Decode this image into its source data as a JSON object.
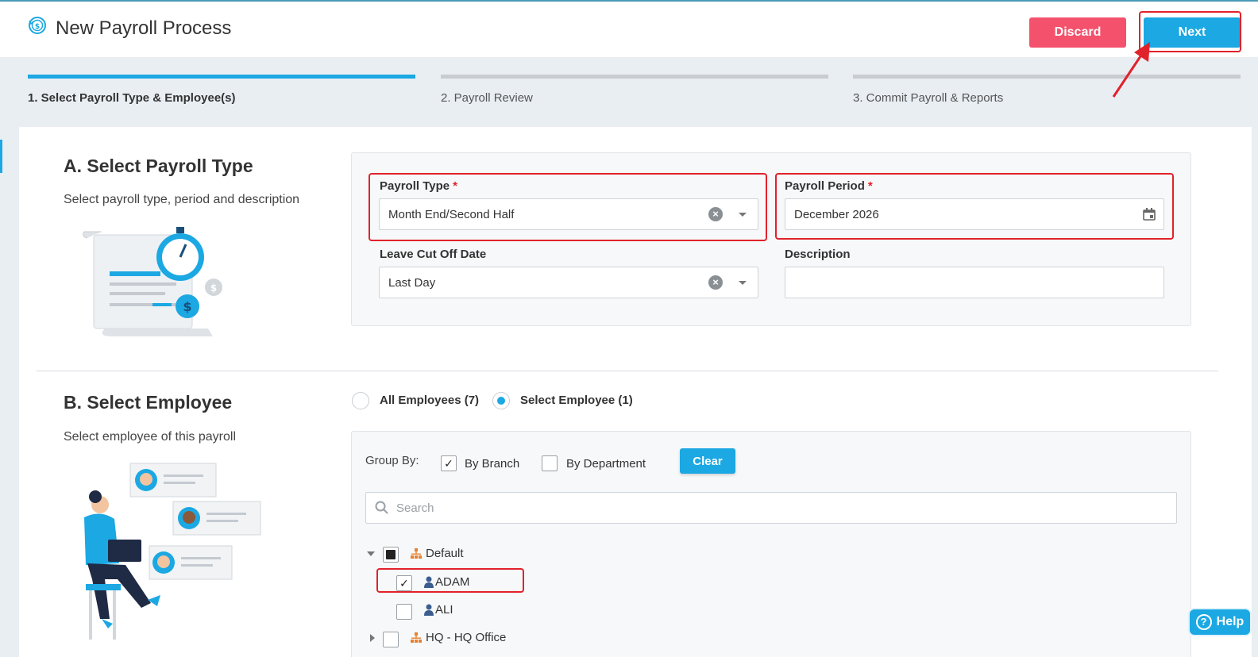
{
  "header": {
    "title": "New Payroll Process",
    "discard_label": "Discard",
    "next_label": "Next"
  },
  "steps": [
    {
      "label": "1. Select Payroll Type & Employee(s)",
      "active": true
    },
    {
      "label": "2. Payroll Review",
      "active": false
    },
    {
      "label": "3. Commit Payroll & Reports",
      "active": false
    }
  ],
  "section_a": {
    "title": "A. Select Payroll Type",
    "subtitle": "Select payroll type, period and description",
    "payroll_type": {
      "label": "Payroll Type",
      "required_mark": "*",
      "value": "Month End/Second Half"
    },
    "payroll_period": {
      "label": "Payroll Period",
      "required_mark": "*",
      "value": "December 2026"
    },
    "leave_cut_off": {
      "label": "Leave Cut Off Date",
      "value": "Last Day"
    },
    "description": {
      "label": "Description",
      "value": ""
    }
  },
  "section_b": {
    "title": "B. Select Employee",
    "subtitle": "Select employee of this payroll",
    "all_employees_label": "All Employees (7)",
    "select_employee_label": "Select Employee (1)",
    "selected_mode": "select",
    "group_by_label": "Group By:",
    "by_branch_label": "By Branch",
    "by_branch_checked": true,
    "by_department_label": "By Department",
    "by_department_checked": false,
    "clear_label": "Clear",
    "search_placeholder": "Search",
    "tree": {
      "default_group": "Default",
      "employees": [
        {
          "name": "ADAM",
          "checked": true
        },
        {
          "name": "ALI",
          "checked": false
        }
      ],
      "hq_group": "HQ - HQ Office"
    }
  },
  "help_label": "Help",
  "colors": {
    "primary": "#1ba8e3",
    "danger": "#f4516c",
    "highlight": "#e1222b"
  }
}
